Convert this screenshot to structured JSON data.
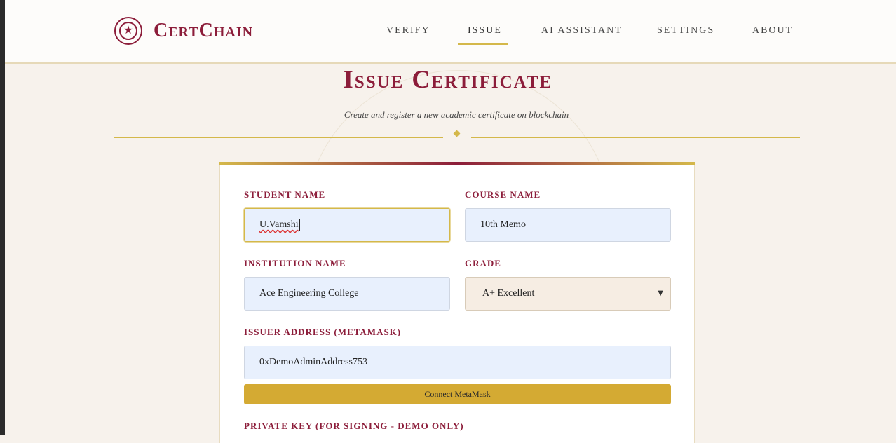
{
  "brand": {
    "name": "CertChain",
    "emblem_icon": "star-icon"
  },
  "nav": {
    "items": [
      {
        "label": "VERIFY"
      },
      {
        "label": "ISSUE",
        "active": true
      },
      {
        "label": "AI ASSISTANT"
      },
      {
        "label": "SETTINGS"
      },
      {
        "label": "ABOUT"
      }
    ]
  },
  "page": {
    "title": "Issue Certificate",
    "subtitle": "Create and register a new academic certificate on blockchain"
  },
  "form": {
    "student_name": {
      "label": "STUDENT NAME",
      "value": "U.Vamshi"
    },
    "course_name": {
      "label": "COURSE NAME",
      "value": "10th Memo"
    },
    "institution_name": {
      "label": "INSTITUTION NAME",
      "value": "Ace Engineering College"
    },
    "grade": {
      "label": "GRADE",
      "selected": "A+ Excellent"
    },
    "issuer_address": {
      "label": "ISSUER ADDRESS (METAMASK)",
      "value": "0xDemoAdminAddress753"
    },
    "connect_button": "Connect MetaMask",
    "private_key": {
      "label": "PRIVATE KEY (FOR SIGNING - DEMO ONLY)"
    }
  },
  "colors": {
    "brand": "#8c1d3a",
    "gold": "#d4b84a",
    "button": "#d4aa33",
    "input_bg": "#e8f0fd",
    "page_bg": "#f7f2ec"
  }
}
